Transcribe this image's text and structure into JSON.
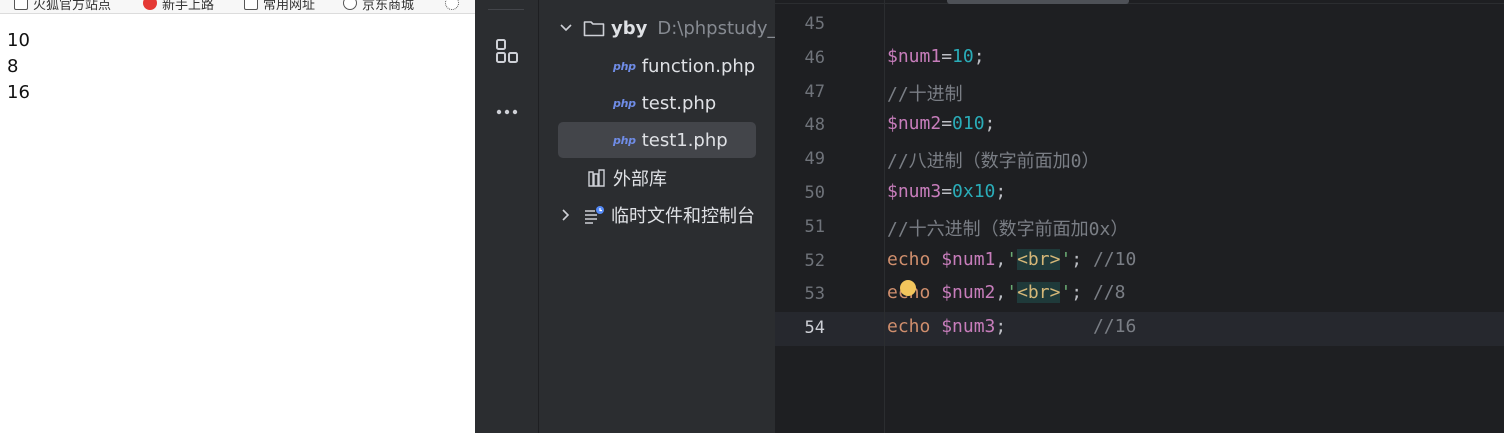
{
  "browser": {
    "bookmarks": [
      "火狐官方站点",
      "新手上路",
      "常用网址",
      "京东商城"
    ],
    "output_lines": [
      "10",
      "8",
      "16"
    ]
  },
  "ide": {
    "toolbar_icons": [
      "structure-icon",
      "more-icon"
    ],
    "tree": {
      "root_name": "yby",
      "root_path": "D:\\phpstudy_p",
      "files": [
        "function.php",
        "test.php",
        "test1.php"
      ],
      "selected_file": "test1.php",
      "file_type_badge": "php",
      "external_libraries": "外部库",
      "scratches": "临时文件和控制台"
    },
    "editor": {
      "current_line": 54,
      "lines": [
        {
          "n": "45",
          "tokens": []
        },
        {
          "n": "46",
          "tokens": [
            [
              "var",
              "$num1"
            ],
            [
              "op",
              "="
            ],
            [
              "num",
              "10"
            ],
            [
              "op",
              ";"
            ]
          ]
        },
        {
          "n": "47",
          "tokens": [
            [
              "cmt",
              "//十进制"
            ]
          ]
        },
        {
          "n": "48",
          "tokens": [
            [
              "var",
              "$num2"
            ],
            [
              "op",
              "="
            ],
            [
              "num",
              "010"
            ],
            [
              "op",
              ";"
            ]
          ]
        },
        {
          "n": "49",
          "tokens": [
            [
              "cmt",
              "//八进制（数字前面加0）"
            ]
          ]
        },
        {
          "n": "50",
          "tokens": [
            [
              "var",
              "$num3"
            ],
            [
              "op",
              "="
            ],
            [
              "num",
              "0x10"
            ],
            [
              "op",
              ";"
            ]
          ]
        },
        {
          "n": "51",
          "tokens": [
            [
              "cmt",
              "//十六进制（数字前面加0x）"
            ]
          ]
        },
        {
          "n": "52",
          "tokens": [
            [
              "kw",
              "echo"
            ],
            [
              "op",
              " "
            ],
            [
              "var",
              "$num1"
            ],
            [
              "op",
              ","
            ],
            [
              "str",
              "'"
            ],
            [
              "tag",
              "<br>"
            ],
            [
              "str",
              "'"
            ],
            [
              "op",
              "; "
            ],
            [
              "cmt",
              "//10"
            ]
          ]
        },
        {
          "n": "53",
          "tokens": [
            [
              "kw",
              "echo"
            ],
            [
              "op",
              " "
            ],
            [
              "var",
              "$num2"
            ],
            [
              "op",
              ","
            ],
            [
              "str",
              "'"
            ],
            [
              "tag",
              "<br>"
            ],
            [
              "str",
              "'"
            ],
            [
              "op",
              "; "
            ],
            [
              "cmt",
              "//8"
            ]
          ]
        },
        {
          "n": "54",
          "tokens": [
            [
              "kw",
              "echo"
            ],
            [
              "op",
              " "
            ],
            [
              "var",
              "$num3"
            ],
            [
              "op",
              ";        "
            ],
            [
              "cmt",
              "//16"
            ]
          ]
        }
      ]
    }
  },
  "colors": {
    "variable": "#c77dbb",
    "number": "#2aacb8",
    "string": "#6aab73",
    "keyword": "#cf8e6d",
    "comment": "#7a7e85",
    "editor_bg": "#1e1f22",
    "panel_bg": "#2b2d30"
  }
}
